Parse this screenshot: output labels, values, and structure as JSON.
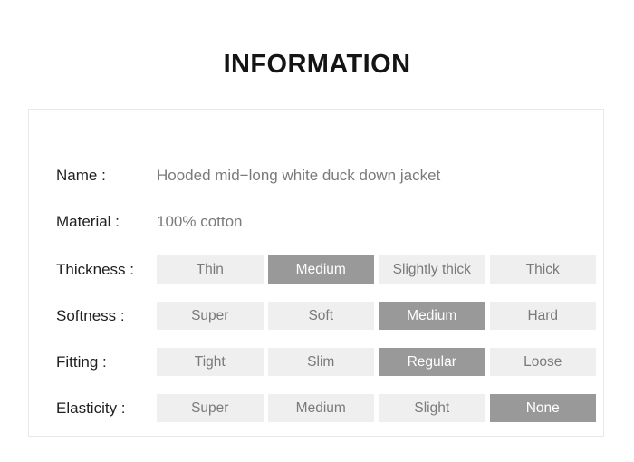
{
  "page": {
    "title": "INFORMATION",
    "background_color": "#ffffff"
  },
  "card": {
    "border_color": "#e8e8e8",
    "background_color": "#ffffff"
  },
  "colors": {
    "label_text": "#1f1f1f",
    "value_text": "#7a7a7a",
    "cell_background": "#efefef",
    "cell_text": "#7a7a7a",
    "cell_selected_background": "#999999",
    "cell_selected_text": "#ffffff"
  },
  "text_rows": [
    {
      "label": "Name :",
      "value": "Hooded mid−long white duck down jacket"
    },
    {
      "label": "Material :",
      "value": "100% cotton"
    }
  ],
  "option_rows": [
    {
      "label": "Thickness :",
      "selected_index": 1,
      "options": [
        {
          "label": "Thin",
          "selected": false
        },
        {
          "label": "Medium",
          "selected": true
        },
        {
          "label": "Slightly thick",
          "selected": false
        },
        {
          "label": "Thick",
          "selected": false
        }
      ]
    },
    {
      "label": "Softness :",
      "selected_index": 2,
      "options": [
        {
          "label": "Super",
          "selected": false
        },
        {
          "label": "Soft",
          "selected": false
        },
        {
          "label": "Medium",
          "selected": true
        },
        {
          "label": "Hard",
          "selected": false
        }
      ]
    },
    {
      "label": "Fitting :",
      "selected_index": 2,
      "options": [
        {
          "label": "Tight",
          "selected": false
        },
        {
          "label": "Slim",
          "selected": false
        },
        {
          "label": "Regular",
          "selected": true
        },
        {
          "label": "Loose",
          "selected": false
        }
      ]
    },
    {
      "label": "Elasticity :",
      "selected_index": 3,
      "options": [
        {
          "label": "Super",
          "selected": false
        },
        {
          "label": "Medium",
          "selected": false
        },
        {
          "label": "Slight",
          "selected": false
        },
        {
          "label": "None",
          "selected": true
        }
      ]
    }
  ]
}
